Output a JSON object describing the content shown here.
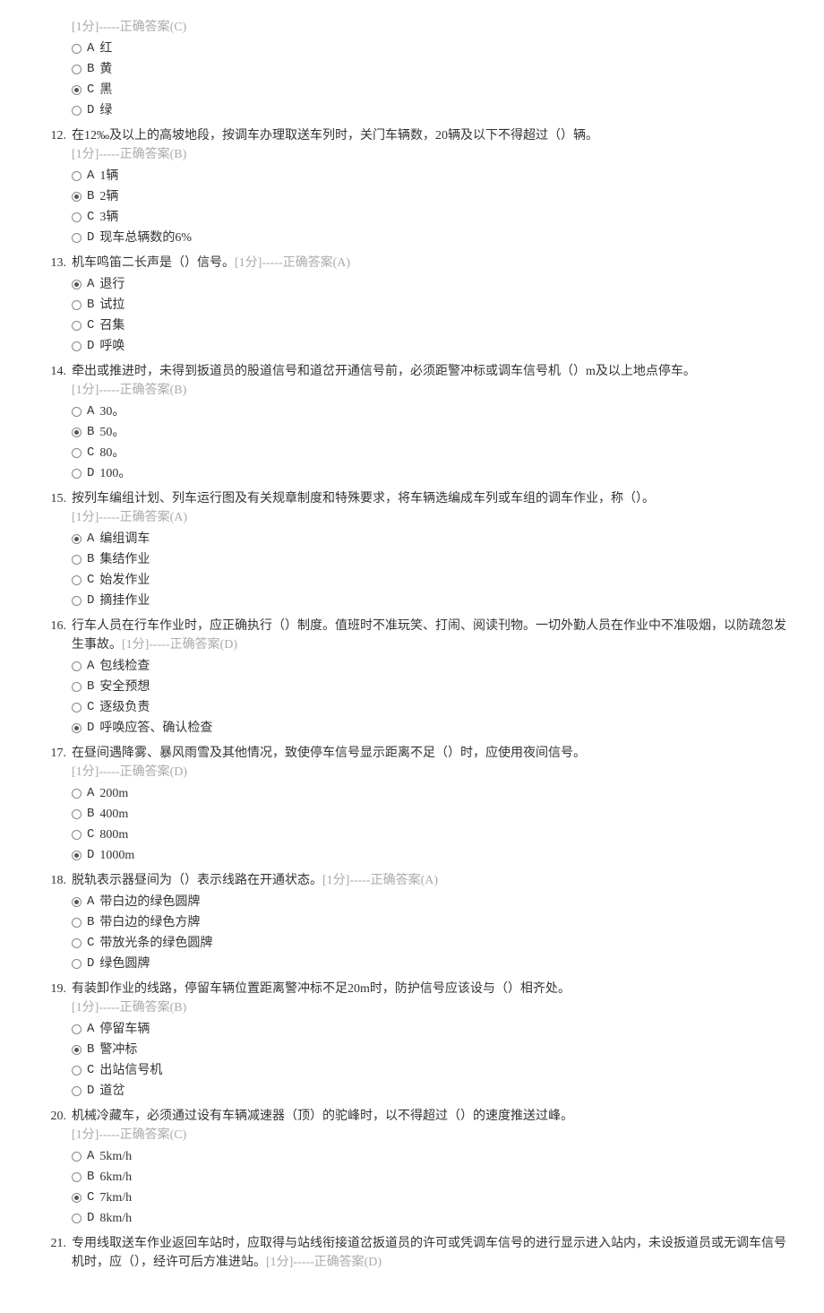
{
  "pre": {
    "meta": "[1分]-----正确答案(C)",
    "answer": "C",
    "options": [
      {
        "letter": "A",
        "text": "红"
      },
      {
        "letter": "B",
        "text": "黄"
      },
      {
        "letter": "C",
        "text": "黑"
      },
      {
        "letter": "D",
        "text": "绿"
      }
    ]
  },
  "questions": [
    {
      "num": "12.",
      "text": "在12‰及以上的高坡地段，按调车办理取送车列时，关门车辆数，20辆及以下不得超过（）辆。",
      "meta": "[1分]-----正确答案(B)",
      "metaInline": false,
      "answer": "B",
      "options": [
        {
          "letter": "A",
          "text": "1辆"
        },
        {
          "letter": "B",
          "text": "2辆"
        },
        {
          "letter": "C",
          "text": "3辆"
        },
        {
          "letter": "D",
          "text": "现车总辆数的6%"
        }
      ]
    },
    {
      "num": "13.",
      "text": "机车鸣笛二长声是（）信号。",
      "meta": "[1分]-----正确答案(A)",
      "metaInline": true,
      "answer": "A",
      "options": [
        {
          "letter": "A",
          "text": "退行"
        },
        {
          "letter": "B",
          "text": "试拉"
        },
        {
          "letter": "C",
          "text": "召集"
        },
        {
          "letter": "D",
          "text": "呼唤"
        }
      ]
    },
    {
      "num": "14.",
      "text": "牵出或推进时，未得到扳道员的股道信号和道岔开通信号前，必须距警冲标或调车信号机（）m及以上地点停车。",
      "meta": "[1分]-----正确答案(B)",
      "metaInline": false,
      "answer": "B",
      "options": [
        {
          "letter": "A",
          "text": "30。"
        },
        {
          "letter": "B",
          "text": "50。"
        },
        {
          "letter": "C",
          "text": "80。"
        },
        {
          "letter": "D",
          "text": "100。"
        }
      ]
    },
    {
      "num": "15.",
      "text": "按列车编组计划、列车运行图及有关规章制度和特殊要求，将车辆选编成车列或车组的调车作业，称（）。",
      "meta": "[1分]-----正确答案(A)",
      "metaInline": false,
      "answer": "A",
      "options": [
        {
          "letter": "A",
          "text": "编组调车"
        },
        {
          "letter": "B",
          "text": "集结作业"
        },
        {
          "letter": "C",
          "text": "始发作业"
        },
        {
          "letter": "D",
          "text": "摘挂作业"
        }
      ]
    },
    {
      "num": "16.",
      "text": "行车人员在行车作业时，应正确执行（）制度。值班时不准玩笑、打闹、阅读刊物。一切外勤人员在作业中不准吸烟，以防疏忽发生事故。",
      "meta": "[1分]-----正确答案(D)",
      "metaInline": true,
      "answer": "D",
      "options": [
        {
          "letter": "A",
          "text": "包线检查"
        },
        {
          "letter": "B",
          "text": "安全预想"
        },
        {
          "letter": "C",
          "text": "逐级负责"
        },
        {
          "letter": "D",
          "text": "呼唤应答、确认检查"
        }
      ]
    },
    {
      "num": "17.",
      "text": "在昼间遇降雾、暴风雨雪及其他情况，致使停车信号显示距离不足（）时，应使用夜间信号。",
      "meta": "[1分]-----正确答案(D)",
      "metaInline": false,
      "answer": "D",
      "options": [
        {
          "letter": "A",
          "text": "200m"
        },
        {
          "letter": "B",
          "text": "400m"
        },
        {
          "letter": "C",
          "text": "800m"
        },
        {
          "letter": "D",
          "text": "1000m"
        }
      ]
    },
    {
      "num": "18.",
      "text": "脱轨表示器昼间为（）表示线路在开通状态。",
      "meta": "[1分]-----正确答案(A)",
      "metaInline": true,
      "answer": "A",
      "options": [
        {
          "letter": "A",
          "text": "带白边的绿色圆牌"
        },
        {
          "letter": "B",
          "text": "带白边的绿色方牌"
        },
        {
          "letter": "C",
          "text": "带放光条的绿色圆牌"
        },
        {
          "letter": "D",
          "text": "绿色圆牌"
        }
      ]
    },
    {
      "num": "19.",
      "text": "有装卸作业的线路，停留车辆位置距离警冲标不足20m时，防护信号应该设与（）相齐处。",
      "meta": "[1分]-----正确答案(B)",
      "metaInline": false,
      "answer": "B",
      "options": [
        {
          "letter": "A",
          "text": "停留车辆"
        },
        {
          "letter": "B",
          "text": "警冲标"
        },
        {
          "letter": "C",
          "text": "出站信号机"
        },
        {
          "letter": "D",
          "text": "道岔"
        }
      ]
    },
    {
      "num": "20.",
      "text": "机械冷藏车，必须通过设有车辆减速器（顶）的驼峰时，以不得超过（）的速度推送过峰。",
      "meta": "[1分]-----正确答案(C)",
      "metaInline": false,
      "answer": "C",
      "options": [
        {
          "letter": "A",
          "text": "5km/h"
        },
        {
          "letter": "B",
          "text": "6km/h"
        },
        {
          "letter": "C",
          "text": "7km/h"
        },
        {
          "letter": "D",
          "text": "8km/h"
        }
      ]
    },
    {
      "num": "21.",
      "text": "专用线取送车作业返回车站时，应取得与站线衔接道岔扳道员的许可或凭调车信号的进行显示进入站内，未设扳道员或无调车信号机时，应（），经许可后方准进站。",
      "meta": "[1分]-----正确答案(D)",
      "metaInline": true,
      "answer": "D",
      "options": []
    }
  ]
}
